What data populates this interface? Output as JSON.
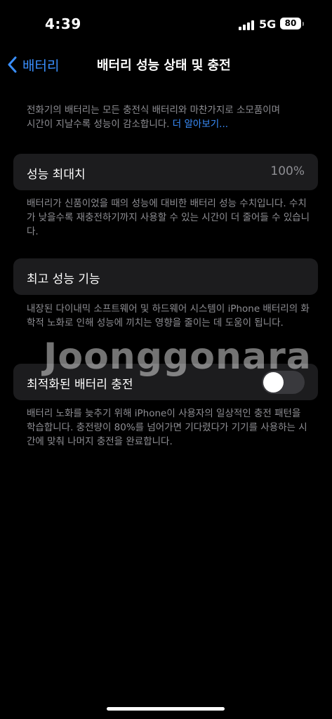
{
  "status_bar": {
    "time": "4:39",
    "network": "5G",
    "battery_level": "80"
  },
  "nav": {
    "back_label": "배터리",
    "title": "배터리 성능 상태 및 충전"
  },
  "intro": {
    "text_line1": "전화기의 배터리는 모든 충전식 배터리와 마찬가지로 소모품이며",
    "text_line2": "시간이 지날수록 성능이 감소합니다.",
    "link": "더 알아보기..."
  },
  "max_capacity": {
    "label": "성능 최대치",
    "value": "100%",
    "description": "배터리가 신품이었을 때의 성능에 대비한 배터리 성능 수치입니다. 수치가 낮을수록 재충전하기까지 사용할 수 있는 시간이 더 줄어들 수 있습니다."
  },
  "peak_performance": {
    "label": "최고 성능 기능",
    "description": "내장된 다이내믹 소프트웨어 및 하드웨어 시스템이 iPhone 배터리의 화학적 노화로 인해 성능에 끼치는 영향을 줄이는 데 도움이 됩니다."
  },
  "optimized_charging": {
    "label": "최적화된 배터리 충전",
    "toggle_on": false,
    "description": "배터리 노화를 늦추기 위해 iPhone이 사용자의 일상적인 충전 패턴을 학습합니다. 충전량이 80%를 넘어가면 기다렸다가 기기를 사용하는 시간에 맞춰 나머지 충전을 완료합니다."
  },
  "watermark": {
    "text": "Joonggonara"
  },
  "colors": {
    "background": "#000000",
    "cell": "#1c1c1e",
    "accent": "#3a8fff",
    "secondary_text": "#8e8e93",
    "toggle_off": "#39393d"
  }
}
